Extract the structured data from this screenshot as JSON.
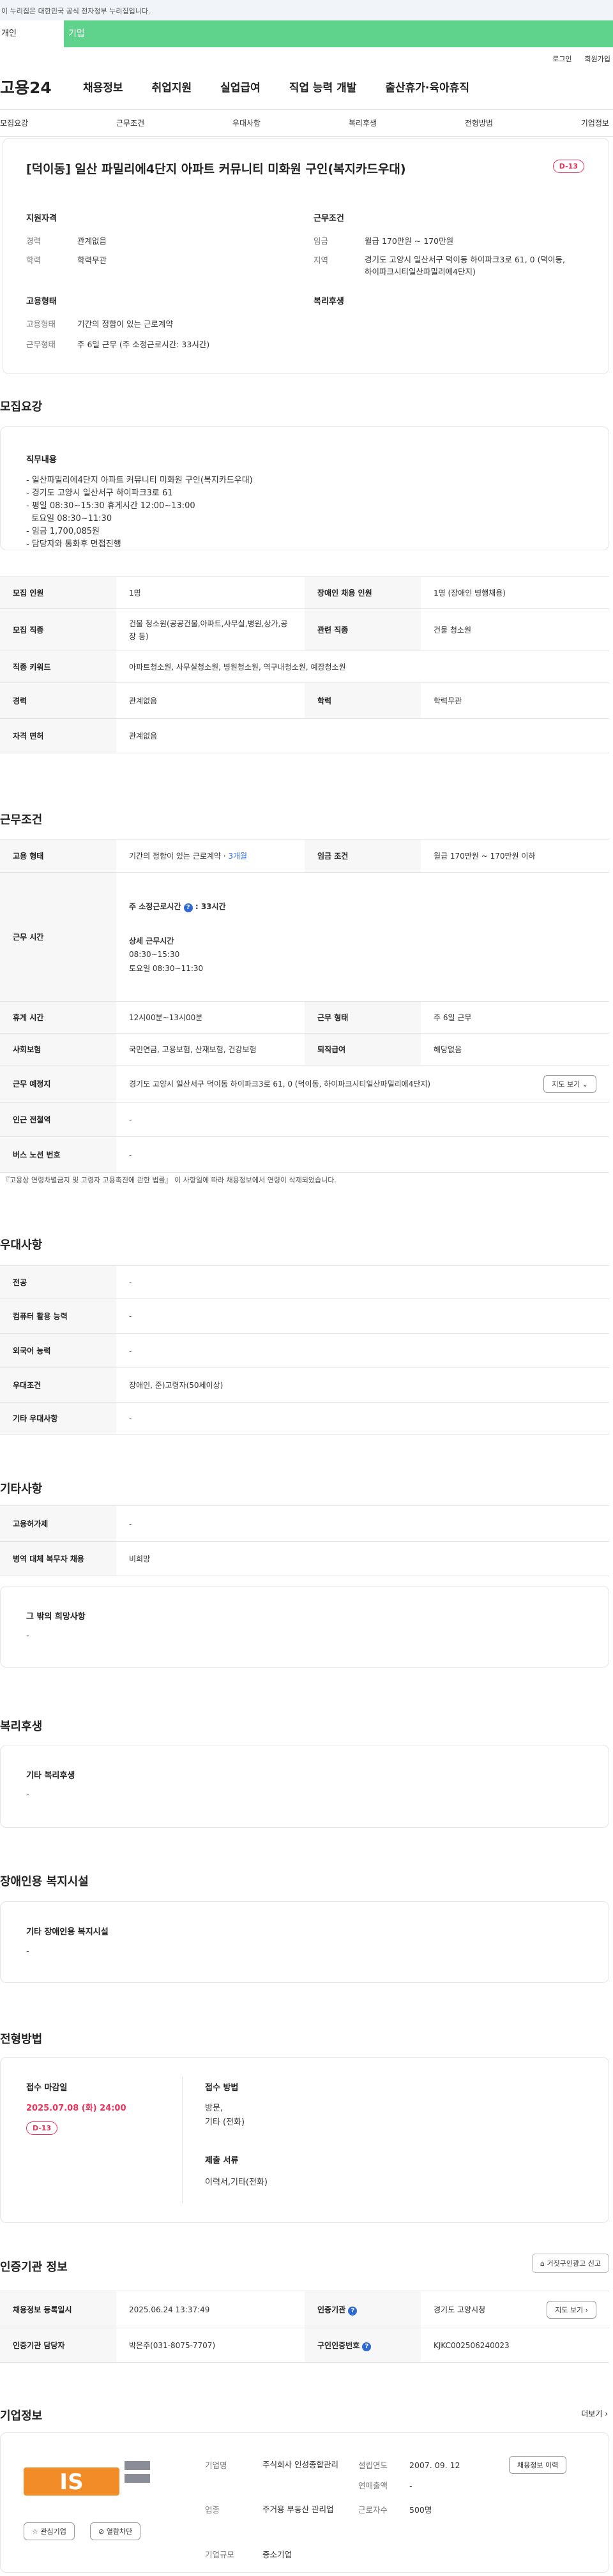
{
  "notice": "이 누리집은 대한민국 공식 전자정부 누리집입니다.",
  "tabs": {
    "self": "개인",
    "enterprise": "기업"
  },
  "util": {
    "login": "로그인",
    "join": "회원가입"
  },
  "logo": "고용24",
  "gnb": [
    "채용정보",
    "취업지원",
    "실업급여",
    "직업 능력 개발",
    "출산휴가·육아휴직"
  ],
  "lnb": [
    "모집요강",
    "근무조건",
    "우대사항",
    "복리후생",
    "전형방법",
    "기업정보"
  ],
  "summary": {
    "title": "[덕이동] 일산 파밀리에4단지 아파트 커뮤니티 미화원 구인(복지카드우대)",
    "dday": "D-13",
    "qual": {
      "title": "지원자격",
      "career_k": "경력",
      "career_v": "관계없음",
      "edu_k": "학력",
      "edu_v": "학력무관"
    },
    "cond": {
      "title": "근무조건",
      "wage_k": "임금",
      "wage_v": "월급 170만원 ~ 170만원",
      "loc_k": "지역",
      "loc_v": "경기도 고양시 일산서구 덕이동 하이파크3로 61, 0 (덕이동, 하이파크시티일산파밀리에4단지)"
    },
    "emp": {
      "title": "고용형태",
      "type_k": "고용형태",
      "type_v": "기간의 정함이 있는 근로계약",
      "hours_k": "근무형태",
      "hours_v": "주 6일 근무 (주 소정근로시간: 33시간)"
    },
    "welfare": {
      "title": "복리후생"
    }
  },
  "recruit": {
    "title": "모집요강",
    "duty_title": "직무내용",
    "duty_lines": [
      "- 일산파밀리에4단지 아파트 커뮤니티 미화원 구인(복지카드우대)",
      "- 경기도 고양시 일산서구 하이파크3로 61",
      "- 평일 08:30~15:30 휴게시간 12:00~13:00",
      "  토요일 08:30~11:30",
      "- 임금 1,700,085원",
      "- 담당자와 통화후 면접진행"
    ],
    "rows": {
      "count_h": "모집 인원",
      "count_v": "1명",
      "dis_h": "장애인 채용 인원",
      "dis_v": "1명 (장애인 병행채용)",
      "job_h": "모집 직종",
      "job_v": "건물 청소원(공공건물,아파트,사무실,병원,상가,공장 등)",
      "rel_h": "관련 직종",
      "rel_v": "건물 청소원",
      "kw_h": "직종 키워드",
      "kw_v": "아파트청소원, 사무실청소원, 병원청소원, 역구내청소원, 예장청소원",
      "career_h": "경력",
      "career_v": "관계없음",
      "edu_h": "학력",
      "edu_v": "학력무관",
      "lic_h": "자격 면허",
      "lic_v": "관계없음"
    }
  },
  "work": {
    "title": "근무조건",
    "emp_h": "고용 형태",
    "emp_v": "기간의 정함이 있는 근로계약 · ",
    "emp_period": "3개월",
    "wage_h": "임금 조건",
    "wage_v": "월급 170만원 ~ 170만원 이하",
    "time_h": "근무 시간",
    "time_weekly_label": "주 소정근로시간",
    "time_weekly_val": ": 33시간",
    "time_detail_label": "상세 근무시간",
    "time_detail_1": "08:30~15:30",
    "time_detail_2": "토요일 08:30~11:30",
    "break_h": "휴게 시간",
    "break_v": "12시00분~13시00분",
    "form_h": "근무 형태",
    "form_v": "주 6일 근무",
    "ins_h": "사회보험",
    "ins_v": "국민연금, 고용보험, 산재보험, 건강보험",
    "ret_h": "퇴직급여",
    "ret_v": "해당없음",
    "place_h": "근무 예정지",
    "place_v": "경기도 고양시 일산서구 덕이동 하이파크3로 61, 0 (덕이동, 하이파크시티일산파밀리에4단지)",
    "map_btn": "지도 보기",
    "station_h": "인근 전철역",
    "station_v": "-",
    "bus_h": "버스 노선 번호",
    "bus_v": "-",
    "note": "『고용상 연령차별금지 및 고령자 고용촉진에 관한 법률』 이 사항일에 따라 채용정보에서 연령이 삭제되었습니다."
  },
  "pref": {
    "title": "우대사항",
    "major_h": "전공",
    "major_v": "-",
    "pc_h": "컴퓨터 활용 능력",
    "pc_v": "-",
    "lang_h": "외국어 능력",
    "lang_v": "-",
    "cond_h": "우대조건",
    "cond_v": "장애인, 준)고령자(50세이상)",
    "etc_h": "기타 우대사항",
    "etc_v": "-"
  },
  "etc": {
    "title": "기타사항",
    "emp_h": "고용허가제",
    "emp_v": "-",
    "mil_h": "병역 대체 복무자 채용",
    "mil_v": "비희망",
    "box_title": "그 밖의 희망사항",
    "box_val": "-"
  },
  "welfare": {
    "title": "복리후생",
    "box_title": "기타 복리후생",
    "box_val": "-"
  },
  "disab": {
    "title": "장애인용 복지시설",
    "box_title": "기타 장애인용 복지시설",
    "box_val": "-"
  },
  "select": {
    "title": "전형방법",
    "deadline_label": "접수 마감일",
    "deadline": "2025.07.08 (화) 24:00",
    "dday": "D-13",
    "method_label": "접수 방법",
    "method_v1": "방문,",
    "method_v2": "기타 (전화)",
    "docs_label": "제출 서류",
    "docs_v": "이력서,기타(전화)"
  },
  "cert": {
    "title": "인증기관 정보",
    "report_btn": "거짓구인광고 신고",
    "reg_h": "채용정보 등록일시",
    "reg_v": "2025.06.24 13:37:49",
    "org_h": "인증기관",
    "org_v": "경기도 고양시청",
    "map_btn": "지도 보기",
    "mgr_h": "인증기관 담당자",
    "mgr_v": "박은주(031-8075-7707)",
    "no_h": "구인인증번호",
    "no_v": "KJKC002506240023"
  },
  "company": {
    "title": "기업정보",
    "more": "더보기",
    "name_k": "기업명",
    "name_v": "주식회사 인성종합관리",
    "est_k": "설립연도",
    "est_v": "2007. 09. 12",
    "sales_k": "연매출액",
    "sales_v": "-",
    "ind_k": "업종",
    "ind_v": "주거용 부동산 관리업",
    "staff_k": "근로자수",
    "staff_v": "500명",
    "size_k": "기업규모",
    "size_v": "중소기업",
    "fav_btn": "관심기업",
    "block_btn": "열람차단",
    "list_btn": "채용정보 이력",
    "colors": {
      "orange": "#f28c28",
      "gray": "#8a8d98"
    }
  }
}
